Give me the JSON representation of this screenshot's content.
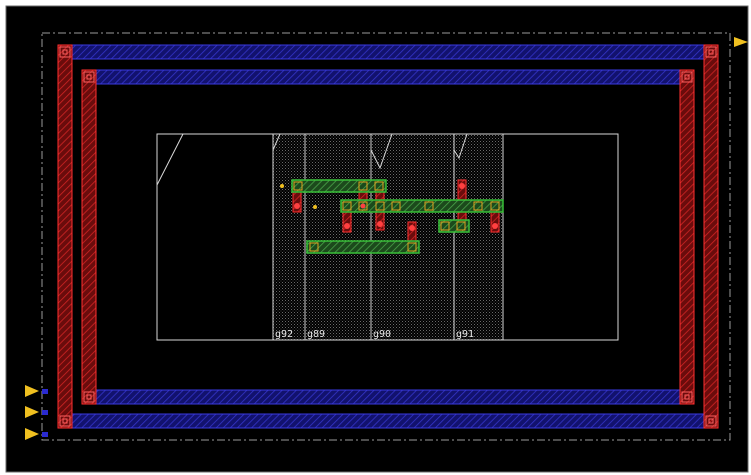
{
  "cells": [
    {
      "name": "g92"
    },
    {
      "name": "g89"
    },
    {
      "name": "g90"
    },
    {
      "name": "g91"
    }
  ],
  "colors": {
    "background": "#000000",
    "canvas_frame": "#6a6a6a",
    "boundary_dashed": "#9a9a9a",
    "metal_horizontal": "#1c1ca8",
    "metal_horizontal_edge": "#3a3ae0",
    "metal_vertical": "#b01818",
    "metal_vertical_edge": "#ff3030",
    "via": "#ff5050",
    "instance_outline": "#d8d8d8",
    "wire_green": "#38c038",
    "pin_marker": "#f0c020",
    "label": "#e8e8e8"
  },
  "icons": {
    "pin": "pin-arrow-icon",
    "via": "via-contact-icon"
  }
}
